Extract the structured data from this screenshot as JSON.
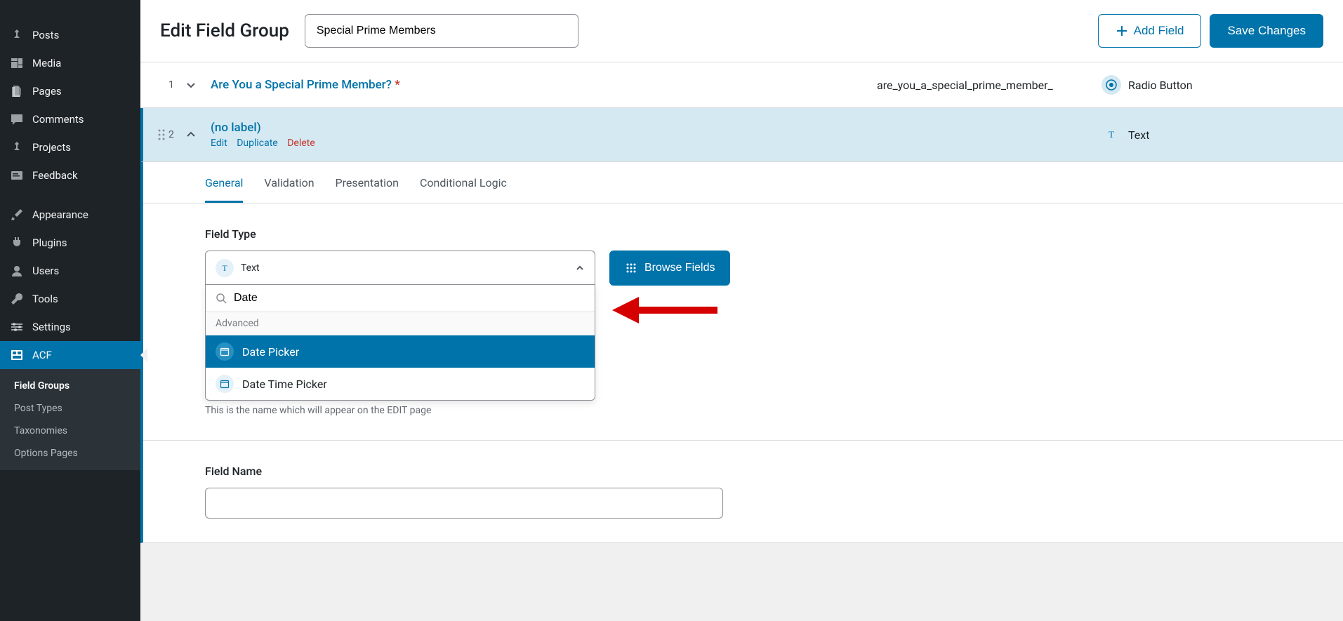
{
  "sidebar": {
    "items": [
      {
        "label": "Posts",
        "icon": "pin"
      },
      {
        "label": "Media",
        "icon": "media"
      },
      {
        "label": "Pages",
        "icon": "pages"
      },
      {
        "label": "Comments",
        "icon": "comment"
      },
      {
        "label": "Projects",
        "icon": "pin"
      },
      {
        "label": "Feedback",
        "icon": "feedback"
      }
    ],
    "items2": [
      {
        "label": "Appearance",
        "icon": "brush"
      },
      {
        "label": "Plugins",
        "icon": "plug"
      },
      {
        "label": "Users",
        "icon": "user"
      },
      {
        "label": "Tools",
        "icon": "wrench"
      },
      {
        "label": "Settings",
        "icon": "settings"
      }
    ],
    "acf": {
      "label": "ACF"
    },
    "submenu": [
      {
        "label": "Field Groups",
        "active": true
      },
      {
        "label": "Post Types"
      },
      {
        "label": "Taxonomies"
      },
      {
        "label": "Options Pages"
      }
    ]
  },
  "header": {
    "title": "Edit Field Group",
    "group_name": "Special Prime Members",
    "add_field": "Add Field",
    "save": "Save Changes"
  },
  "rows": [
    {
      "num": "1",
      "label": "Are You a Special Prime Member?",
      "required": "*",
      "name": "are_you_a_special_prime_member_",
      "type": "Radio Button"
    },
    {
      "num": "2",
      "label": "(no label)",
      "type": "Text"
    }
  ],
  "row_actions": {
    "edit": "Edit",
    "duplicate": "Duplicate",
    "delete": "Delete"
  },
  "tabs": [
    "General",
    "Validation",
    "Presentation",
    "Conditional Logic"
  ],
  "editor": {
    "field_type_label": "Field Type",
    "selected_type": "Text",
    "search_value": "Date",
    "group_label": "Advanced",
    "options": [
      "Date Picker",
      "Date Time Picker"
    ],
    "browse_fields": "Browse Fields",
    "help_text": "This is the name which will appear on the EDIT page",
    "field_name_label": "Field Name"
  }
}
